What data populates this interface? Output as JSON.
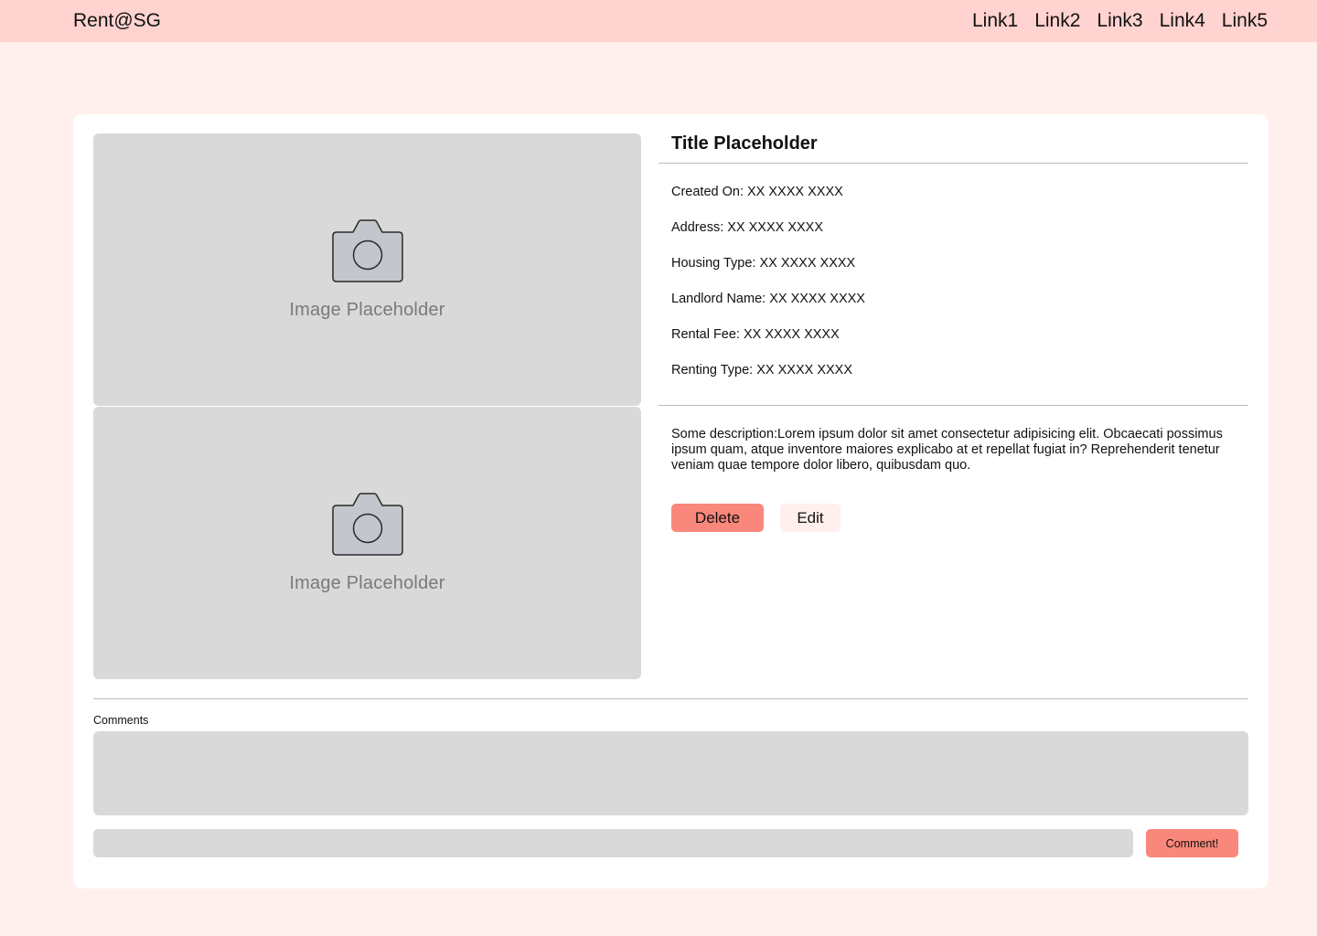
{
  "nav": {
    "brand": "Rent@SG",
    "links": [
      "Link1",
      "Link2",
      "Link3",
      "Link4",
      "Link5"
    ]
  },
  "images": [
    {
      "label": "Image Placeholder",
      "icon": "camera-icon"
    },
    {
      "label": "Image Placeholder",
      "icon": "camera-icon"
    }
  ],
  "listing": {
    "title": "Title Placeholder",
    "fields": [
      "Created On: XX XXXX XXXX",
      "Address: XX XXXX XXXX",
      "Housing Type: XX XXXX XXXX",
      "Landlord Name: XX XXXX XXXX",
      "Rental Fee: XX XXXX XXXX",
      "Renting Type: XX XXXX XXXX"
    ],
    "description": "Some description:Lorem ipsum dolor sit amet consectetur adipisicing elit. Obcaecati possimus ipsum quam, atque inventore maiores explicabo at et repellat fugiat in? Reprehenderit tenetur veniam quae tempore dolor libero, quibusdam quo.",
    "delete_label": "Delete",
    "edit_label": "Edit"
  },
  "comments": {
    "label": "Comments",
    "input_value": "",
    "submit_label": "Comment!"
  },
  "colors": {
    "navbar_bg": "#ffd3cf",
    "page_bg": "#fff0ee",
    "accent": "#fa877b",
    "placeholder_gray": "#d9d9d9"
  }
}
